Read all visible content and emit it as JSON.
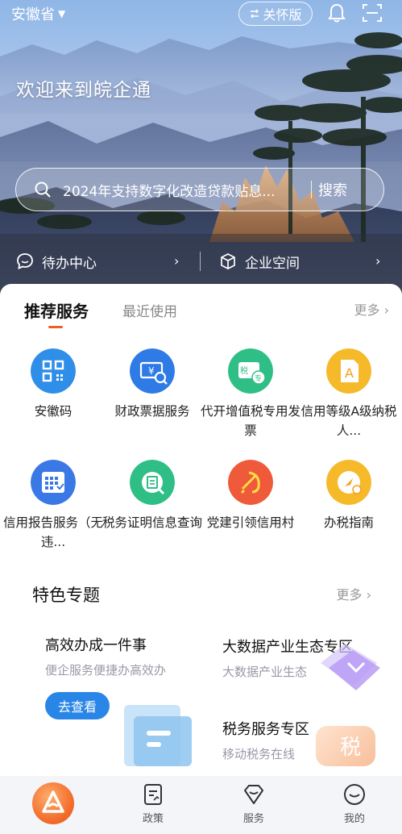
{
  "header": {
    "province": "安徽省",
    "care_mode": "关怀版",
    "welcome": "欢迎来到皖企通"
  },
  "search": {
    "text": "2024年支持数字化改造贷款贴息...",
    "button": "搜索"
  },
  "quick": {
    "todo": "待办中心",
    "space": "企业空间"
  },
  "tabs": {
    "recommended": "推荐服务",
    "recent": "最近使用",
    "more": "更多"
  },
  "services": [
    {
      "label": "安徽码",
      "icon": "qr-code-icon",
      "color": "#2f8ee8"
    },
    {
      "label": "财政票据服务",
      "icon": "fiscal-receipt-icon",
      "color": "#2f7be6"
    },
    {
      "label": "代开增值税专用发票",
      "icon": "tax-invoice-icon",
      "color": "#2fbf86"
    },
    {
      "label": "信用等级A级纳税人...",
      "icon": "credit-a-icon",
      "color": "#f5b92a"
    },
    {
      "label": "信用报告服务（无违...",
      "icon": "credit-report-icon",
      "color": "#3a78e6"
    },
    {
      "label": "税务证明信息查询",
      "icon": "tax-certificate-icon",
      "color": "#2fbf86"
    },
    {
      "label": "党建引领信用村",
      "icon": "party-emblem-icon",
      "color": "#ef5a3a"
    },
    {
      "label": "办税指南",
      "icon": "tax-guide-icon",
      "color": "#f5b92a"
    }
  ],
  "featured": {
    "title": "特色专题",
    "more": "更多",
    "items": [
      {
        "title": "高效办成一件事",
        "subtitle": "便企服务便捷办高效办",
        "button": "去查看"
      },
      {
        "title": "大数据产业生态专区",
        "subtitle": "大数据产业生态"
      },
      {
        "title": "税务服务专区",
        "subtitle": "移动税务在线",
        "badge": "税"
      }
    ]
  },
  "nav": {
    "policy": "政策",
    "service": "服务",
    "mine": "我的"
  },
  "colors": {
    "accent": "#e8602a",
    "primary_blue": "#2a86e6"
  }
}
